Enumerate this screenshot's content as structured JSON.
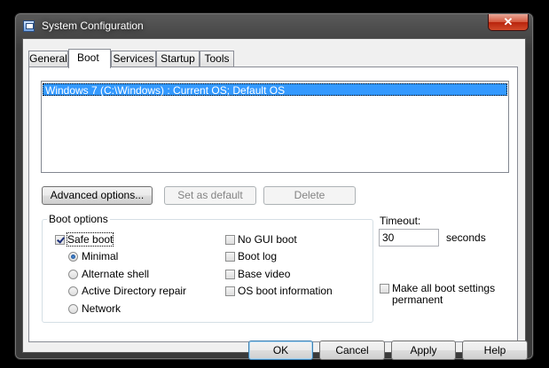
{
  "window": {
    "title": "System Configuration",
    "close_glyph": "✕"
  },
  "tabs": [
    {
      "label": "General"
    },
    {
      "label": "Boot"
    },
    {
      "label": "Services"
    },
    {
      "label": "Startup"
    },
    {
      "label": "Tools"
    }
  ],
  "boot_list": {
    "entries": [
      "Windows 7 (C:\\Windows) : Current OS; Default OS"
    ]
  },
  "boot_buttons": {
    "advanced": "Advanced options...",
    "set_default": "Set as default",
    "delete": "Delete"
  },
  "boot_options": {
    "legend": "Boot options",
    "safe_boot": {
      "label": "Safe boot",
      "checked": true
    },
    "radios": [
      {
        "label": "Minimal",
        "selected": true
      },
      {
        "label": "Alternate shell",
        "selected": false
      },
      {
        "label": "Active Directory repair",
        "selected": false
      },
      {
        "label": "Network",
        "selected": false
      }
    ],
    "checks": [
      {
        "label": "No GUI boot",
        "checked": false
      },
      {
        "label": "Boot log",
        "checked": false
      },
      {
        "label": "Base video",
        "checked": false
      },
      {
        "label": "OS boot information",
        "checked": false
      }
    ]
  },
  "timeout": {
    "label": "Timeout:",
    "value": "30",
    "unit": "seconds"
  },
  "make_permanent": {
    "line1": "Make all boot settings",
    "line2": "permanent",
    "checked": false
  },
  "dialog_buttons": {
    "ok": "OK",
    "cancel": "Cancel",
    "apply": "Apply",
    "help": "Help"
  }
}
